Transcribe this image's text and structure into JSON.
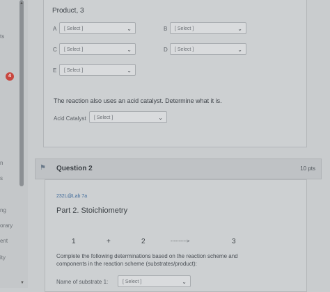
{
  "sidebar": {
    "texts": [
      "ts",
      "n",
      "s",
      "ng",
      "orary",
      "ent",
      "ity"
    ],
    "badge": "4"
  },
  "question1": {
    "product_label": "Product, 3",
    "selects": [
      {
        "letter": "A",
        "placeholder": "[ Select ]"
      },
      {
        "letter": "B",
        "placeholder": "[ Select ]"
      },
      {
        "letter": "C",
        "placeholder": "[ Select ]"
      },
      {
        "letter": "D",
        "placeholder": "[ Select ]"
      },
      {
        "letter": "E",
        "placeholder": "[ Select ]"
      }
    ],
    "catalyst_prompt": "The reaction also uses an acid catalyst. Determine what it is.",
    "catalyst_label": "Acid Catalyst",
    "catalyst_placeholder": "[ Select ]"
  },
  "question2": {
    "title": "Question 2",
    "points": "10 pts",
    "lab_code": "232L@Lab 7a",
    "part_title": "Part 2. Stoichiometry",
    "scheme": {
      "left": "1",
      "plus": "+",
      "middle": "2",
      "arrow": "---------->",
      "right": "3"
    },
    "instructions": "Complete the following determinations based on the reaction scheme and components in the reaction scheme (substrates/product):",
    "substrate_label": "Name of substrate 1:",
    "substrate_placeholder": "[ Select ]"
  }
}
